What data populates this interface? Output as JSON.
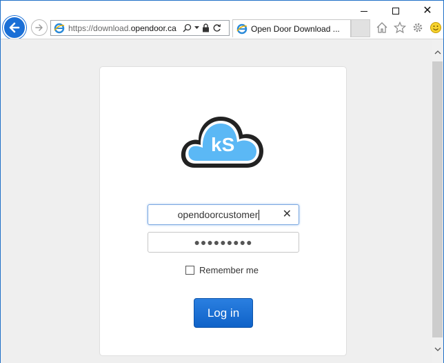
{
  "window": {
    "minimize_icon": "minimize-icon",
    "maximize_icon": "maximize-icon",
    "close_glyph": "✕"
  },
  "nav": {
    "url_prefix": "https://download.",
    "url_domain": "opendoor.ca",
    "tab_title": "Open Door Download ...",
    "colors": {
      "back_button": "#1a6fd6"
    }
  },
  "login": {
    "logo_text": "kS",
    "username": "opendoorcustomer",
    "password_mask": "●●●●●●●●●",
    "remember_label": "Remember me",
    "remember_checked": false,
    "login_label": "Log in",
    "colors": {
      "button": "#0f62c8",
      "cloud": "#5bb8f5"
    }
  }
}
